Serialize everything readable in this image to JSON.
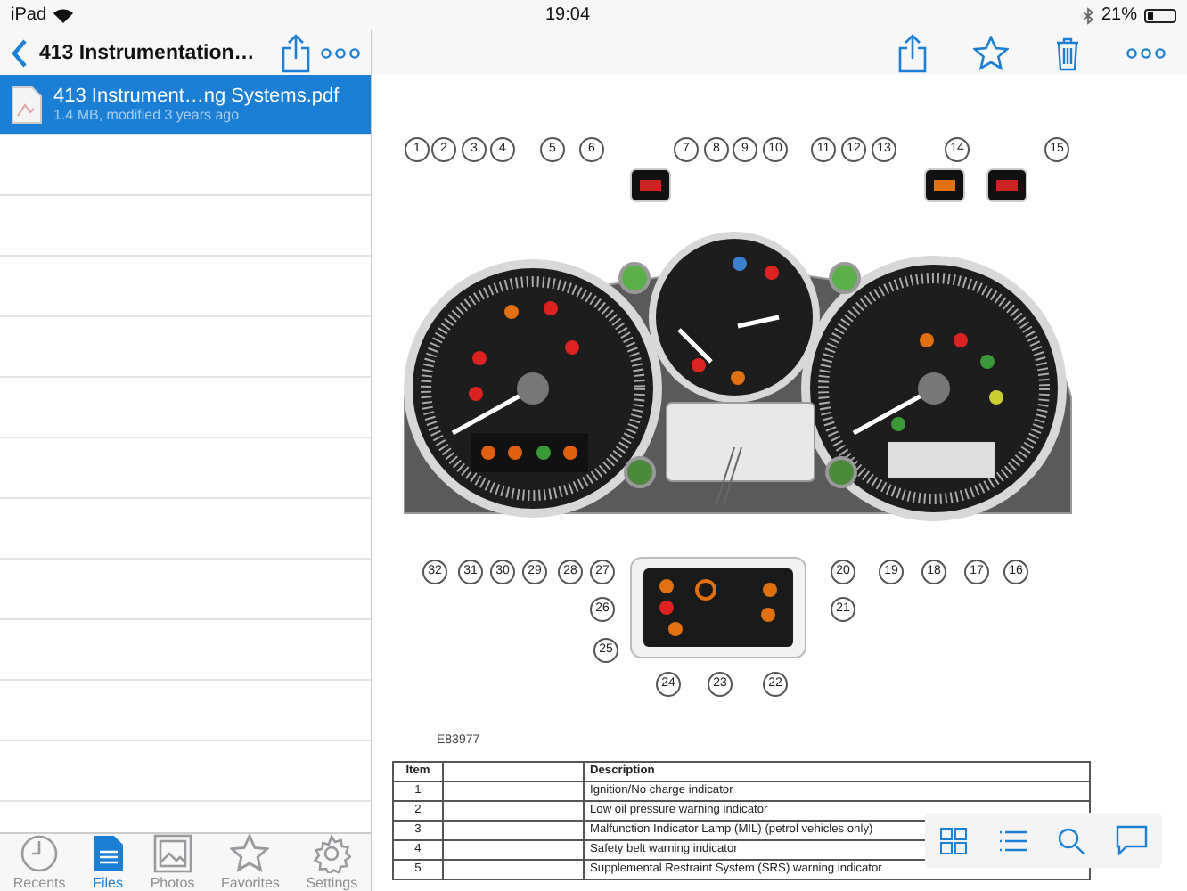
{
  "status_bar": {
    "device": "iPad",
    "time": "19:04",
    "battery": "21%"
  },
  "sidebar": {
    "title": "413 Instrumentation…",
    "files": [
      {
        "name": "413 Instrument…ng Systems.pdf",
        "meta": "1.4 MB, modified 3 years ago",
        "selected": true
      }
    ]
  },
  "tab_bar": [
    {
      "label": "Recents",
      "selected": false
    },
    {
      "label": "Files",
      "selected": true
    },
    {
      "label": "Photos",
      "selected": false
    },
    {
      "label": "Favorites",
      "selected": false
    },
    {
      "label": "Settings",
      "selected": false
    }
  ],
  "figure": {
    "callouts": [
      "1",
      "2",
      "3",
      "4",
      "5",
      "6",
      "7",
      "8",
      "9",
      "10",
      "11",
      "12",
      "13",
      "14",
      "15",
      "32",
      "31",
      "30",
      "29",
      "28",
      "27",
      "20",
      "19",
      "18",
      "17",
      "16",
      "26",
      "21",
      "25",
      "24",
      "23",
      "22"
    ],
    "code": "E83977"
  },
  "table": {
    "item_heading": "Item",
    "description_heading": "Description",
    "rows": [
      {
        "item": "1",
        "description": "Ignition/No charge indicator"
      },
      {
        "item": "2",
        "description": "Low oil pressure warning indicator"
      },
      {
        "item": "3",
        "description": "Malfunction Indicator Lamp (MIL) (petrol vehicles only)"
      },
      {
        "item": "4",
        "description": "Safety belt warning indicator"
      },
      {
        "item": "5",
        "description": "Supplemental Restraint System (SRS) warning indicator"
      }
    ]
  }
}
